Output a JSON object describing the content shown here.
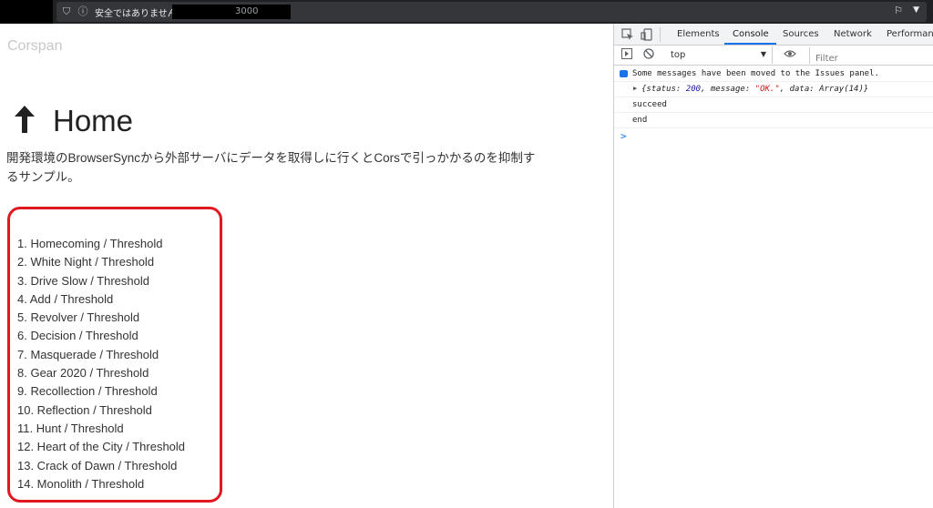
{
  "browser": {
    "security_label": "安全ではありません",
    "url_port": "3000"
  },
  "page": {
    "brand": "Corspan",
    "title": "Home",
    "description": "開発環境のBrowserSyncから外部サーバにデータを取得しに行くとCorsで引っかかるのを抑制するサンプル。",
    "list": [
      "1. Homecoming / Threshold",
      "2. White Night / Threshold",
      "3. Drive Slow / Threshold",
      "4. Add / Threshold",
      "5. Revolver / Threshold",
      "6. Decision / Threshold",
      "7. Masquerade / Threshold",
      "8. Gear 2020 / Threshold",
      "9. Recollection / Threshold",
      "10. Reflection / Threshold",
      "11. Hunt / Threshold",
      "12. Heart of the City / Threshold",
      "13. Crack of Dawn / Threshold",
      "14. Monolith / Threshold"
    ],
    "highlight_color": "#e0181f"
  },
  "devtools": {
    "tabs": [
      "Elements",
      "Console",
      "Sources",
      "Network",
      "Performanc"
    ],
    "active_tab": "Console",
    "context": "top",
    "filter_placeholder": "Filter",
    "console": {
      "issues_msg": "Some messages have been moved to the Issues panel.",
      "obj_prefix": "{status: ",
      "obj_status": "200",
      "obj_mid": ", message: ",
      "obj_message": "\"OK.\"",
      "obj_suffix": ", data: Array(14)}",
      "line3": "succeed",
      "line4": "end",
      "prompt": ">"
    },
    "accent": "#1a73e8"
  }
}
